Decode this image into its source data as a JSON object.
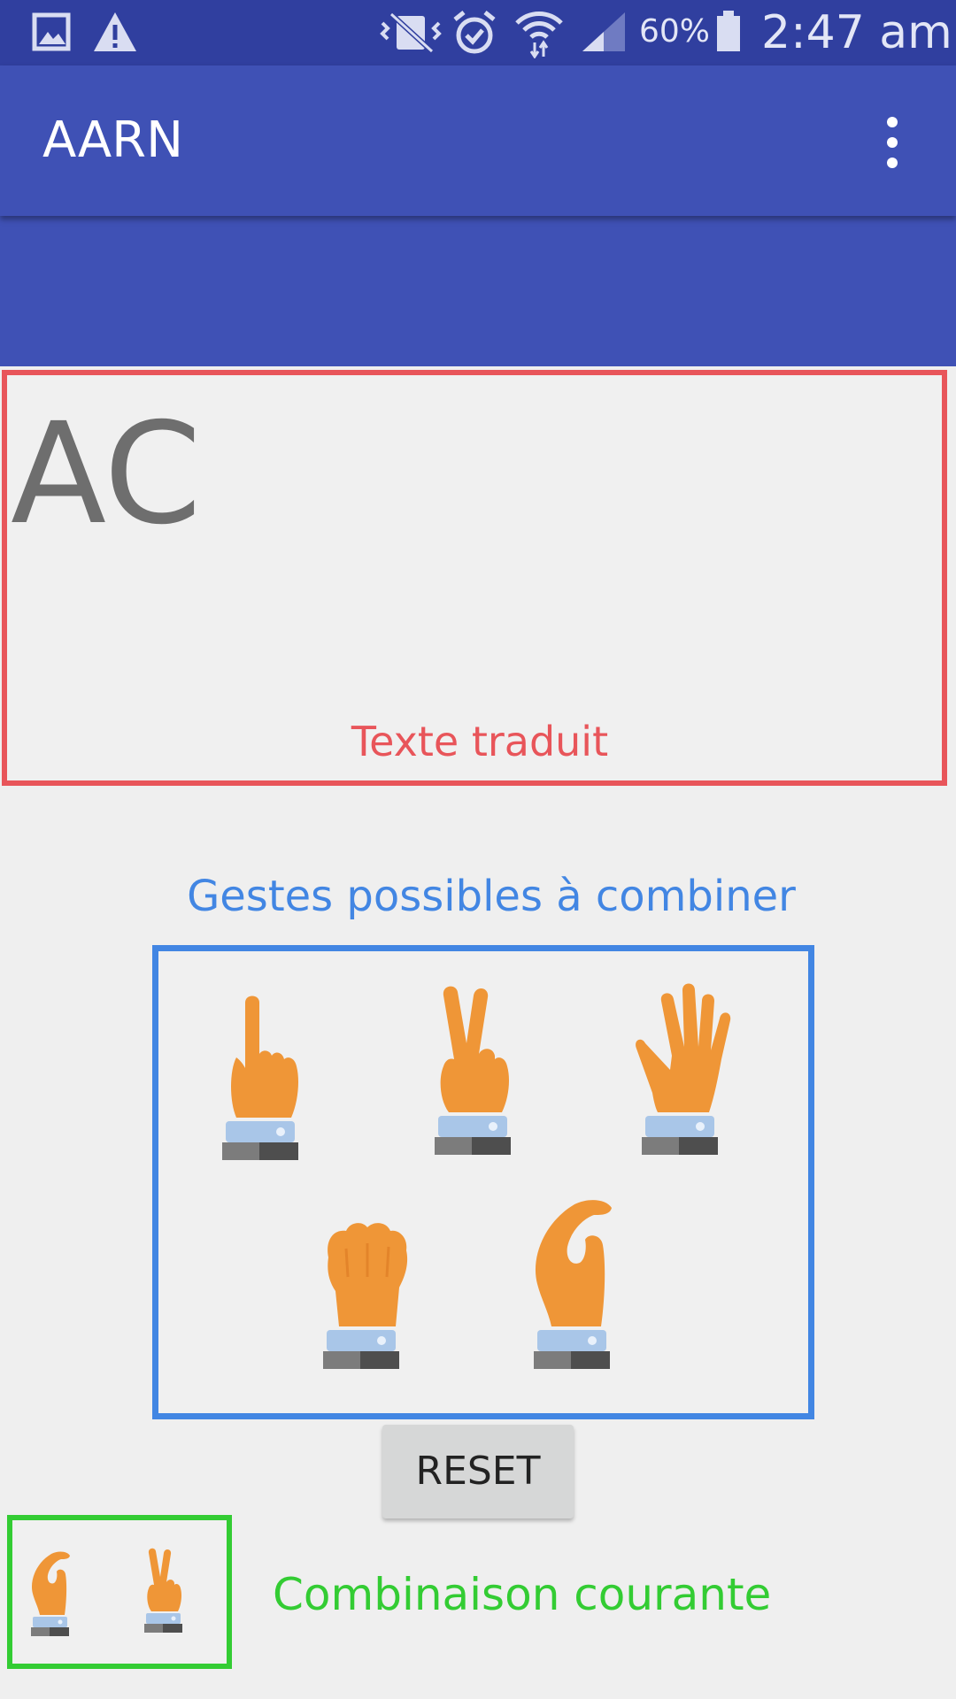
{
  "status_bar": {
    "icons": [
      "gallery-icon",
      "warning-icon",
      "vibrate-icon",
      "alarm-icon",
      "wifi-icon",
      "signal-icon",
      "battery-icon"
    ],
    "battery": "60%",
    "time": "2:47 am"
  },
  "app_bar": {
    "title": "AARN",
    "overflow_icon": "more-vert-icon"
  },
  "translated": {
    "value": "AC",
    "label": "Texte traduit"
  },
  "gestures": {
    "label": "Gestes possibles à combiner",
    "items": [
      "index-finger-gesture",
      "two-fingers-gesture",
      "open-hand-gesture",
      "fist-gesture",
      "c-hand-gesture"
    ]
  },
  "reset": {
    "label": "RESET"
  },
  "combination": {
    "label": "Combinaison courante",
    "items": [
      "c-hand-gesture",
      "two-fingers-gesture"
    ]
  },
  "colors": {
    "status_bar": "#303f9f",
    "app_bar": "#3f51b5",
    "translated_border": "#e8555a",
    "gestures_border": "#4286e3",
    "combination_border": "#33cc33",
    "hand": "#ef9637",
    "cuff": "#a9c6e8"
  }
}
